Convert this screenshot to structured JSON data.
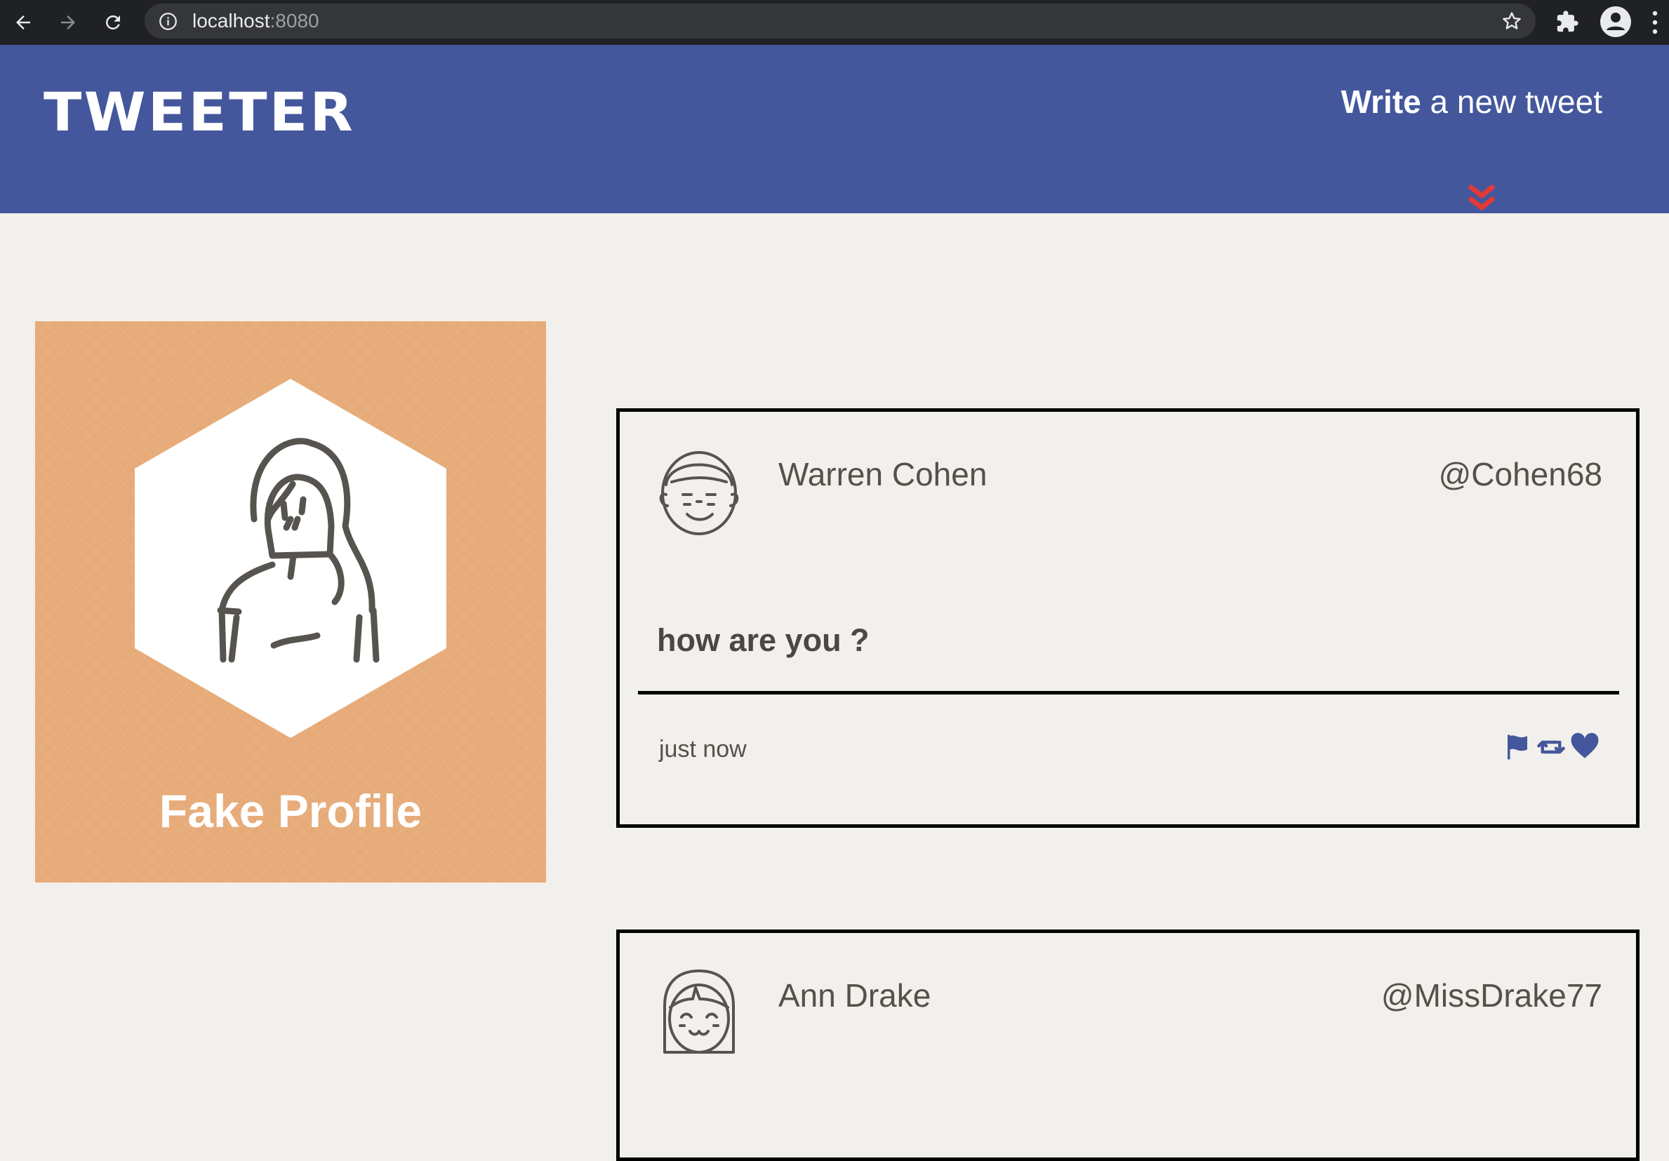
{
  "browser": {
    "url_host": "localhost",
    "url_port": ":8080",
    "icons": [
      "back-icon",
      "forward-icon",
      "reload-icon",
      "info-icon",
      "star-icon",
      "extensions-icon",
      "profile-icon",
      "kebab-menu-icon"
    ]
  },
  "header": {
    "logo": "TWEETER",
    "compose_strong": "Write",
    "compose_rest": " a new tweet",
    "compose_icon": "double-chevron-down-icon",
    "colors": {
      "background": "#44579c",
      "chevron": "#e53935"
    }
  },
  "profile": {
    "name": "Fake Profile",
    "avatar_icon": "woman-avatar-icon",
    "colors": {
      "card": "#e6ab78"
    }
  },
  "tweets": [
    {
      "author": "Warren Cohen",
      "handle": "@Cohen68",
      "avatar_icon": "man-avatar-icon",
      "body": "how are you ?",
      "time": "just now",
      "actions": [
        "flag-icon",
        "retweet-icon",
        "heart-icon"
      ]
    },
    {
      "author": "Ann Drake",
      "handle": "@MissDrake77",
      "avatar_icon": "girl-avatar-icon"
    }
  ],
  "colors": {
    "page_background": "#f2f0ec",
    "action_icon": "#44579c"
  }
}
